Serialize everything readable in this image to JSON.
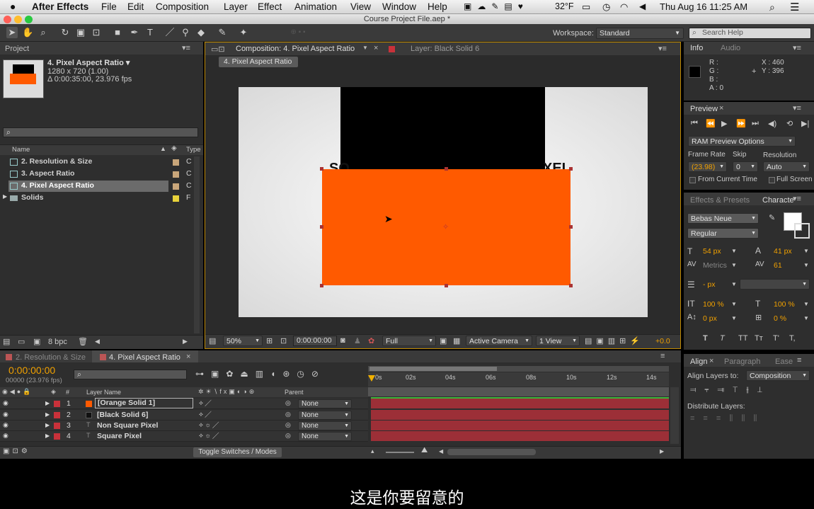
{
  "menubar": {
    "app": "After Effects",
    "items": [
      "File",
      "Edit",
      "Composition",
      "Layer",
      "Effect",
      "Animation",
      "View",
      "Window",
      "Help"
    ],
    "temperature": "32°F",
    "datetime": "Thu Aug 16  11:25 AM"
  },
  "window": {
    "title": "Course Project File.aep *"
  },
  "toolbar": {
    "workspace_label": "Workspace:",
    "workspace_value": "Standard",
    "search_placeholder": "Search Help"
  },
  "project": {
    "tab": "Project",
    "item_name": "4. Pixel Aspect Ratio ▾",
    "item_size": "1280 x 720 (1.00)",
    "item_duration": "Δ 0:00:35:00, 23.976 fps",
    "search_value": "",
    "col_name": "Name",
    "col_type": "Type",
    "items": [
      {
        "name": "2. Resolution & Size",
        "color": "#c9a67a",
        "type": "C",
        "kind": "comp"
      },
      {
        "name": "3. Aspect Ratio",
        "color": "#c9a67a",
        "type": "C",
        "kind": "comp"
      },
      {
        "name": "4. Pixel Aspect Ratio",
        "color": "#c9a67a",
        "type": "C",
        "kind": "comp",
        "selected": true
      },
      {
        "name": "Solids",
        "color": "#e8d23a",
        "type": "F",
        "kind": "folder"
      }
    ],
    "bpc": "8 bpc"
  },
  "composition": {
    "tab": "Composition: 4. Pixel Aspect Ratio",
    "layer_tab": "Layer: Black Solid 6",
    "breadcrumb": "4. Pixel Aspect Ratio",
    "bg_text_left": "SQ",
    "bg_text_right": "XEL",
    "zoom": "50%",
    "timecode": "0:00:00:00",
    "resolution": "Full",
    "camera": "Active Camera",
    "view": "1 View",
    "exposure": "+0.0"
  },
  "info": {
    "tab": "Info",
    "tab2": "Audio",
    "r": "R :",
    "g": "G :",
    "b": "B :",
    "a": "A : 0",
    "x": "X : 460",
    "y": "Y : 396"
  },
  "preview": {
    "tab": "Preview",
    "ram_options": "RAM Preview Options",
    "frame_rate_label": "Frame Rate",
    "skip_label": "Skip",
    "resolution_label": "Resolution",
    "frame_rate": "(23.98)",
    "skip": "0",
    "resolution": "Auto",
    "from_current": "From Current Time",
    "full_screen": "Full Screen"
  },
  "character": {
    "tab1": "Effects & Presets",
    "tab2": "Characte",
    "font": "Bebas Neue",
    "style": "Regular",
    "size": "54 px",
    "leading": "41 px",
    "kerning": "Metrics",
    "tracking": "61",
    "stroke": "- px",
    "vscale": "100 %",
    "hscale": "100 %",
    "baseline": "0 px",
    "tsume": "0 %",
    "styles": [
      "T",
      "T",
      "TT",
      "Tт",
      "T'",
      "T,"
    ]
  },
  "align": {
    "tab1": "Align",
    "tab2": "Paragraph",
    "tab3": "Ease",
    "align_to_label": "Align Layers to:",
    "align_to": "Composition",
    "distribute": "Distribute Layers:"
  },
  "timeline": {
    "tab1": "2. Resolution & Size",
    "tab2": "4. Pixel Aspect Ratio",
    "timecode": "0:00:00:00",
    "fps": "00000 (23.976 fps)",
    "col_layer_name": "Layer Name",
    "col_parent": "Parent",
    "col_num": "#",
    "toggle": "Toggle Switches / Modes",
    "ruler": [
      "0s",
      "02s",
      "04s",
      "06s",
      "08s",
      "10s",
      "12s",
      "14s"
    ],
    "layers": [
      {
        "num": "1",
        "name": "[Orange Solid 1]",
        "swatch": "#ff5a00",
        "parent": "None",
        "selected": true
      },
      {
        "num": "2",
        "name": "[Black Solid 6]",
        "swatch": "#111111",
        "parent": "None"
      },
      {
        "num": "3",
        "name": "Non Square Pixel",
        "swatch": "",
        "parent": "None"
      },
      {
        "num": "4",
        "name": "Square Pixel",
        "swatch": "",
        "parent": "None"
      }
    ]
  },
  "subtitle": "这是你要留意的"
}
